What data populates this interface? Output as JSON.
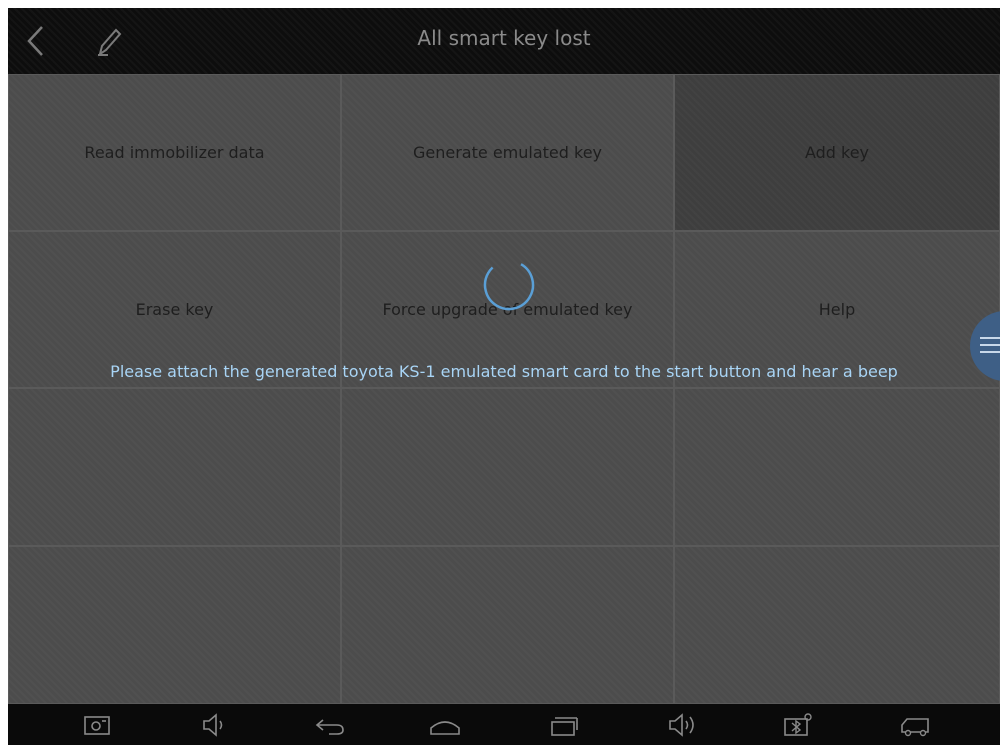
{
  "header": {
    "title": "All smart key lost",
    "back_icon": "chevron-left-icon",
    "edit_icon": "pencil-icon"
  },
  "functions": [
    {
      "label": "Read immobilizer data"
    },
    {
      "label": "Generate emulated key"
    },
    {
      "label": "Add key"
    },
    {
      "label": "Erase key"
    },
    {
      "label": "Force upgrade of emulated key"
    },
    {
      "label": "Help"
    }
  ],
  "dialog": {
    "message": "Please attach the generated toyota KS-1 emulated smart card to the start button and hear a beep",
    "spinner_icon": "loading-spinner-icon"
  },
  "floating_menu": {
    "icon": "hamburger-menu-icon"
  },
  "navbar": {
    "items": [
      {
        "icon": "screenshot-icon"
      },
      {
        "icon": "volume-down-icon"
      },
      {
        "icon": "back-icon"
      },
      {
        "icon": "home-icon"
      },
      {
        "icon": "recent-apps-icon"
      },
      {
        "icon": "volume-up-icon"
      },
      {
        "icon": "bluetooth-device-icon"
      },
      {
        "icon": "vehicle-icon"
      }
    ]
  },
  "colors": {
    "message_text": "#a8d4f5",
    "floating_button": "#3e5f86",
    "spinner": "#5a9fd6"
  }
}
